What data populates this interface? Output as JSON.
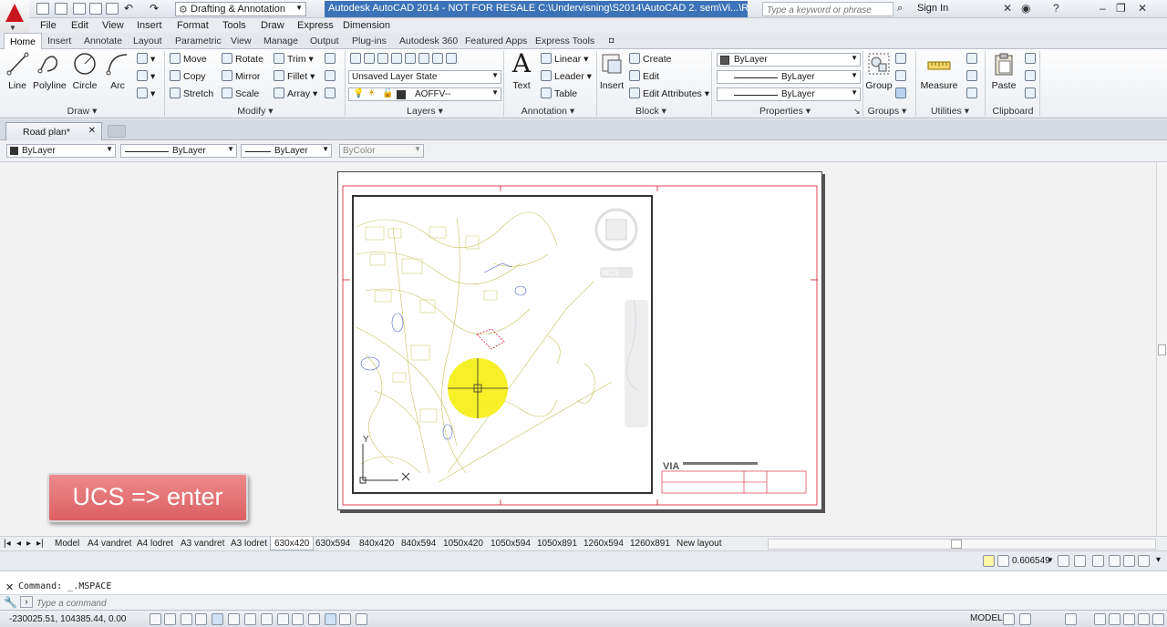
{
  "app": {
    "title": "Autodesk AutoCAD 2014 - NOT FOR RESALE    C:\\Undervisning\\S2014\\AutoCAD 2. sem\\Vi...\\Road plan.dwg",
    "workspace": "Drafting & Annotation",
    "search_placeholder": "Type a keyword or phrase",
    "sign_in": "Sign In"
  },
  "menubar": [
    "File",
    "Edit",
    "View",
    "Insert",
    "Format",
    "Tools",
    "Draw",
    "Express",
    "Dimension"
  ],
  "ribbon_tabs": [
    "Home",
    "Insert",
    "Annotate",
    "Layout",
    "Parametric",
    "View",
    "Manage",
    "Output",
    "Plug-ins",
    "Autodesk 360",
    "Featured Apps",
    "Express Tools"
  ],
  "ribbon": {
    "draw": {
      "title": "Draw",
      "tools": [
        "Line",
        "Polyline",
        "Circle",
        "Arc"
      ]
    },
    "modify": {
      "title": "Modify",
      "tools": [
        "Move",
        "Rotate",
        "Trim",
        "Copy",
        "Mirror",
        "Fillet",
        "Stretch",
        "Scale",
        "Array"
      ]
    },
    "layers": {
      "title": "Layers",
      "layer_state": "Unsaved Layer State",
      "current_layer": "AOFFV--"
    },
    "annotation": {
      "title": "Annotation",
      "text": "Text",
      "linear": "Linear",
      "leader": "Leader",
      "table": "Table"
    },
    "block": {
      "title": "Block",
      "insert": "Insert",
      "create": "Create",
      "edit": "Edit",
      "edit_attributes": "Edit Attributes"
    },
    "properties": {
      "title": "Properties",
      "color": "ByLayer",
      "linetype": "ByLayer",
      "lineweight": "ByLayer"
    },
    "groups": {
      "title": "Groups",
      "group": "Group"
    },
    "utilities": {
      "title": "Utilities",
      "measure": "Measure"
    },
    "clipboard": {
      "title": "Clipboard",
      "paste": "Paste"
    }
  },
  "document_tab": "Road plan*",
  "props_bar": {
    "color": "ByLayer",
    "linetype": "ByLayer",
    "lineweight": "ByLayer",
    "plotstyle": "ByColor"
  },
  "viewport": {
    "wcs_label": "WCS",
    "ucs_y": "Y",
    "ucs_x": "X",
    "titleblock_logo": "VIA"
  },
  "layout_tabs": [
    "Model",
    "A4 vandret",
    "A4 lodret",
    "A3 vandret",
    "A3 lodret",
    "630x420",
    "630x594",
    "840x420",
    "840x594",
    "1050x420",
    "1050x594",
    "1050x891",
    "1260x594",
    "1260x891",
    "New layout"
  ],
  "active_layout": "630x420",
  "status": {
    "scale": "0.606549",
    "model": "MODEL",
    "coordinates": "-230025.51, 104385.44, 0.00"
  },
  "command": {
    "history": "Command: _.MSPACE",
    "placeholder": "Type a command"
  },
  "callout": "UCS => enter",
  "colors": {
    "accent": "#3c73b8",
    "autocad_red": "#c8161d",
    "callout": "#e07377",
    "highlight": "#f5ef1c"
  }
}
